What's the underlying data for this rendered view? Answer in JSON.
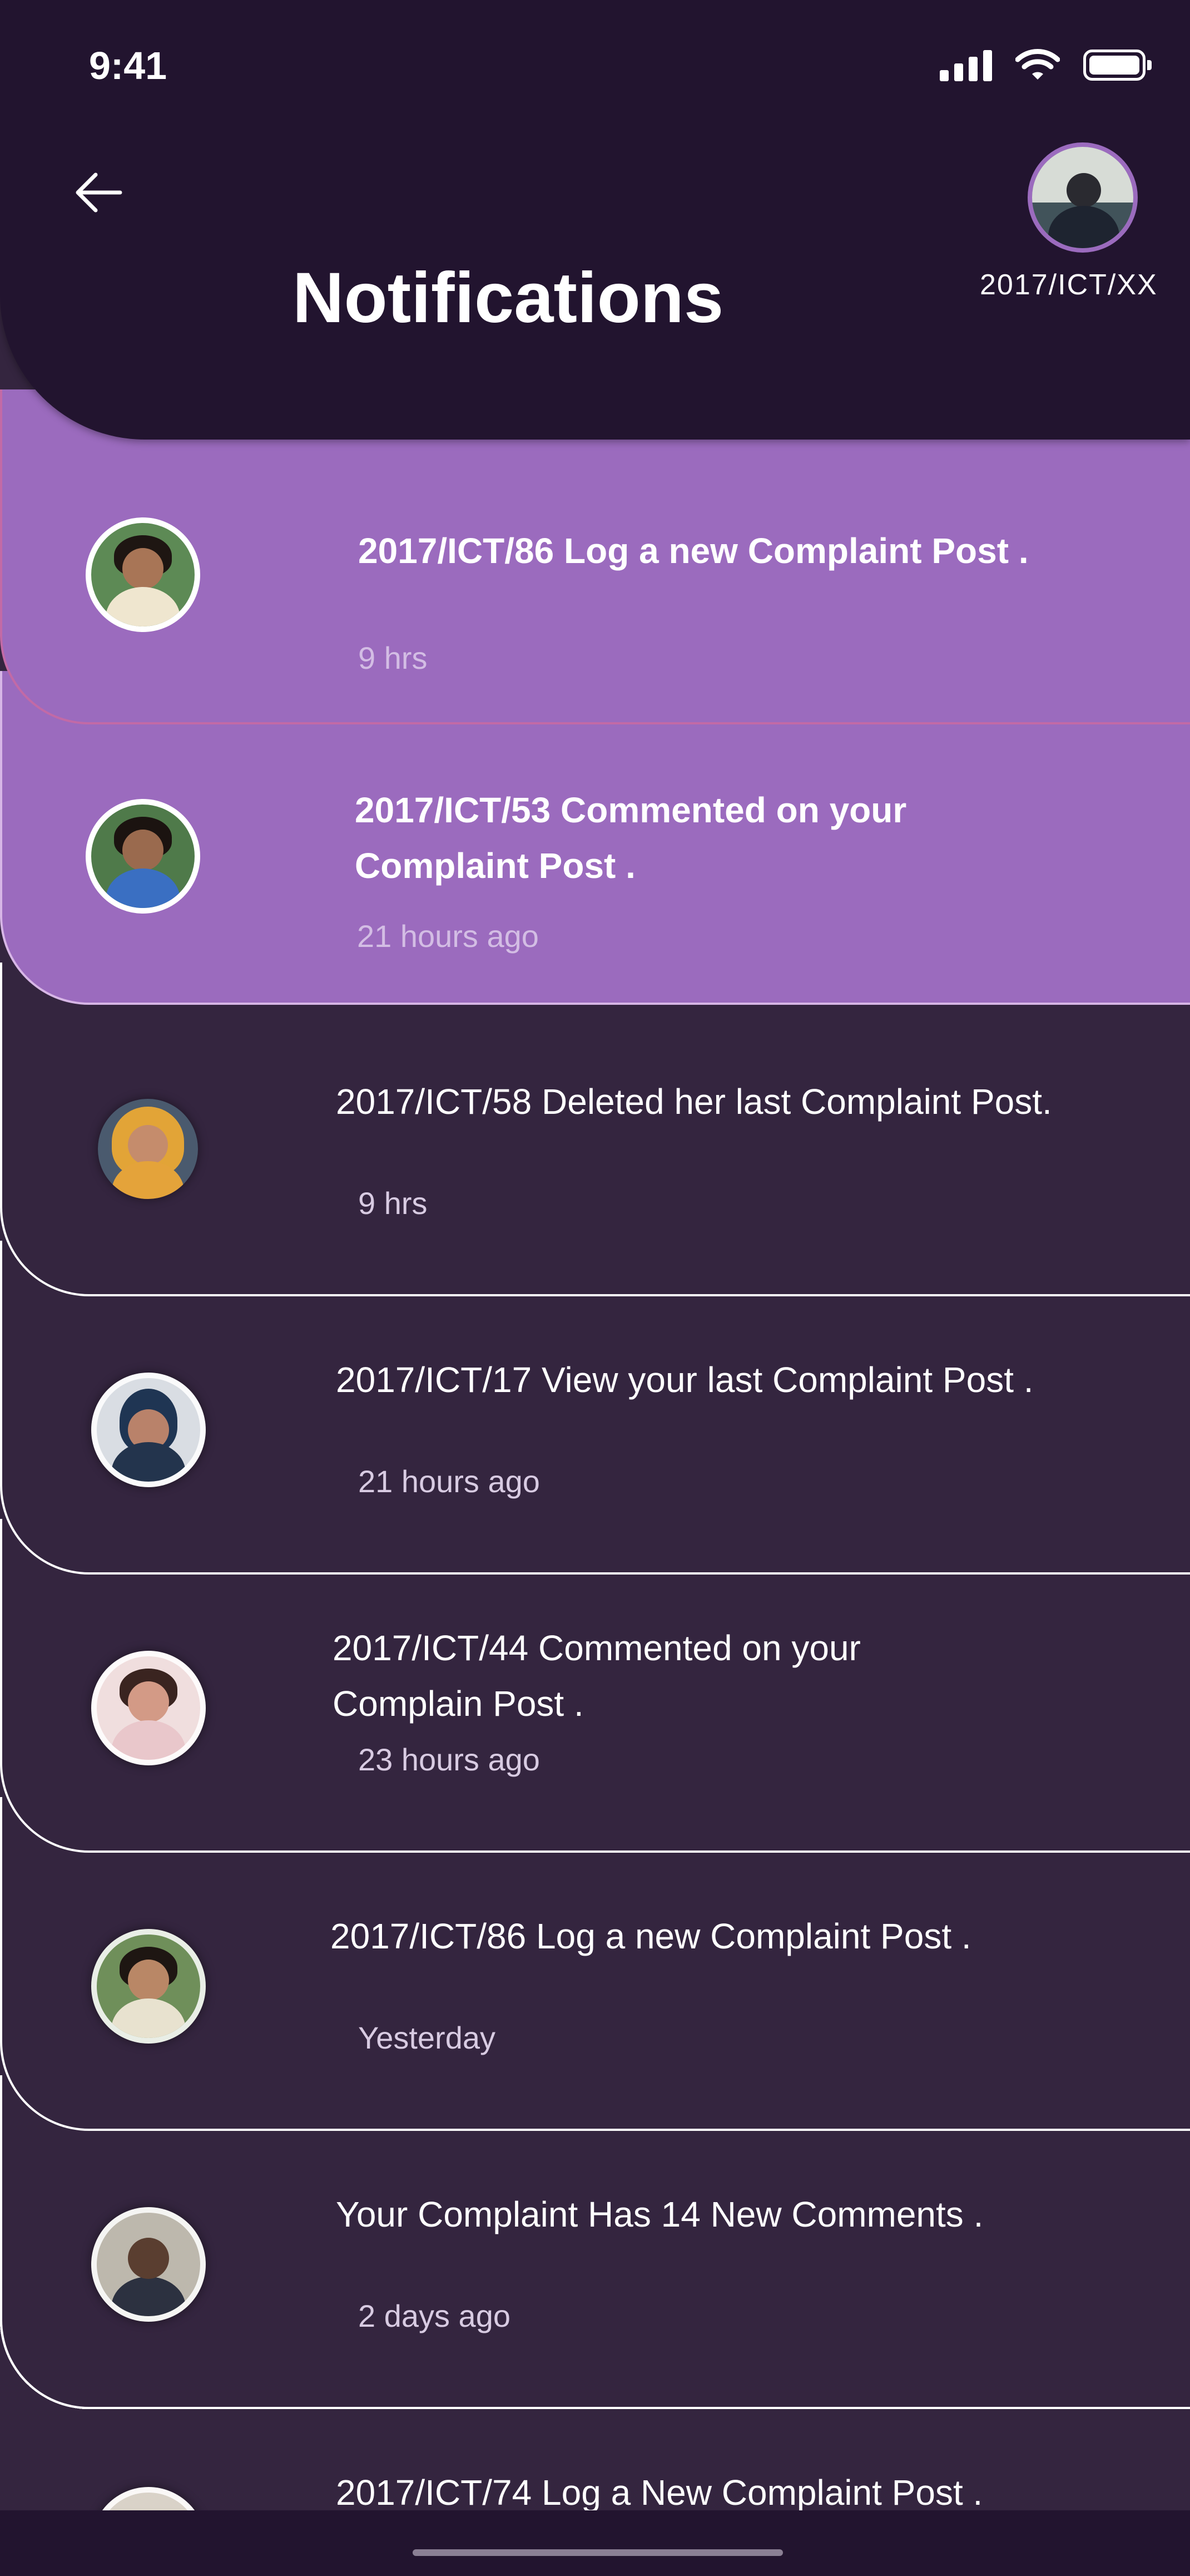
{
  "status_bar": {
    "time": "9:41",
    "icons": [
      "signal-icon",
      "wifi-icon",
      "battery-icon"
    ]
  },
  "header": {
    "back_icon": "arrow-left-icon",
    "title": "Notifications",
    "profile_id": "2017/ICT/XX"
  },
  "colors": {
    "header_bg": "#22142f",
    "page_bg": "#34253f",
    "unread_bg": "#9b6bbe",
    "profile_ring": "#9b6bbe"
  },
  "notifications": [
    {
      "message": "2017/ICT/86 Log a new Complaint Post .",
      "time": "9 hrs",
      "unread": true
    },
    {
      "message": "2017/ICT/53 Commented on your Complaint Post .",
      "time": "21 hours ago",
      "unread": true
    },
    {
      "message": "2017/ICT/58 Deleted her last Complaint Post.",
      "time": "9 hrs",
      "unread": false
    },
    {
      "message": "2017/ICT/17 View your last Complaint Post .",
      "time": "21 hours ago",
      "unread": false
    },
    {
      "message": "2017/ICT/44 Commented on your Complain Post .",
      "time": "23 hours ago",
      "unread": false
    },
    {
      "message": "2017/ICT/86 Log a new Complaint Post .",
      "time": "Yesterday",
      "unread": false
    },
    {
      "message": "Your Complaint Has 14 New Comments .",
      "time": "2 days ago",
      "unread": false
    },
    {
      "message": "2017/ICT/74 Log a New Complaint Post .",
      "time": "",
      "unread": false
    }
  ]
}
